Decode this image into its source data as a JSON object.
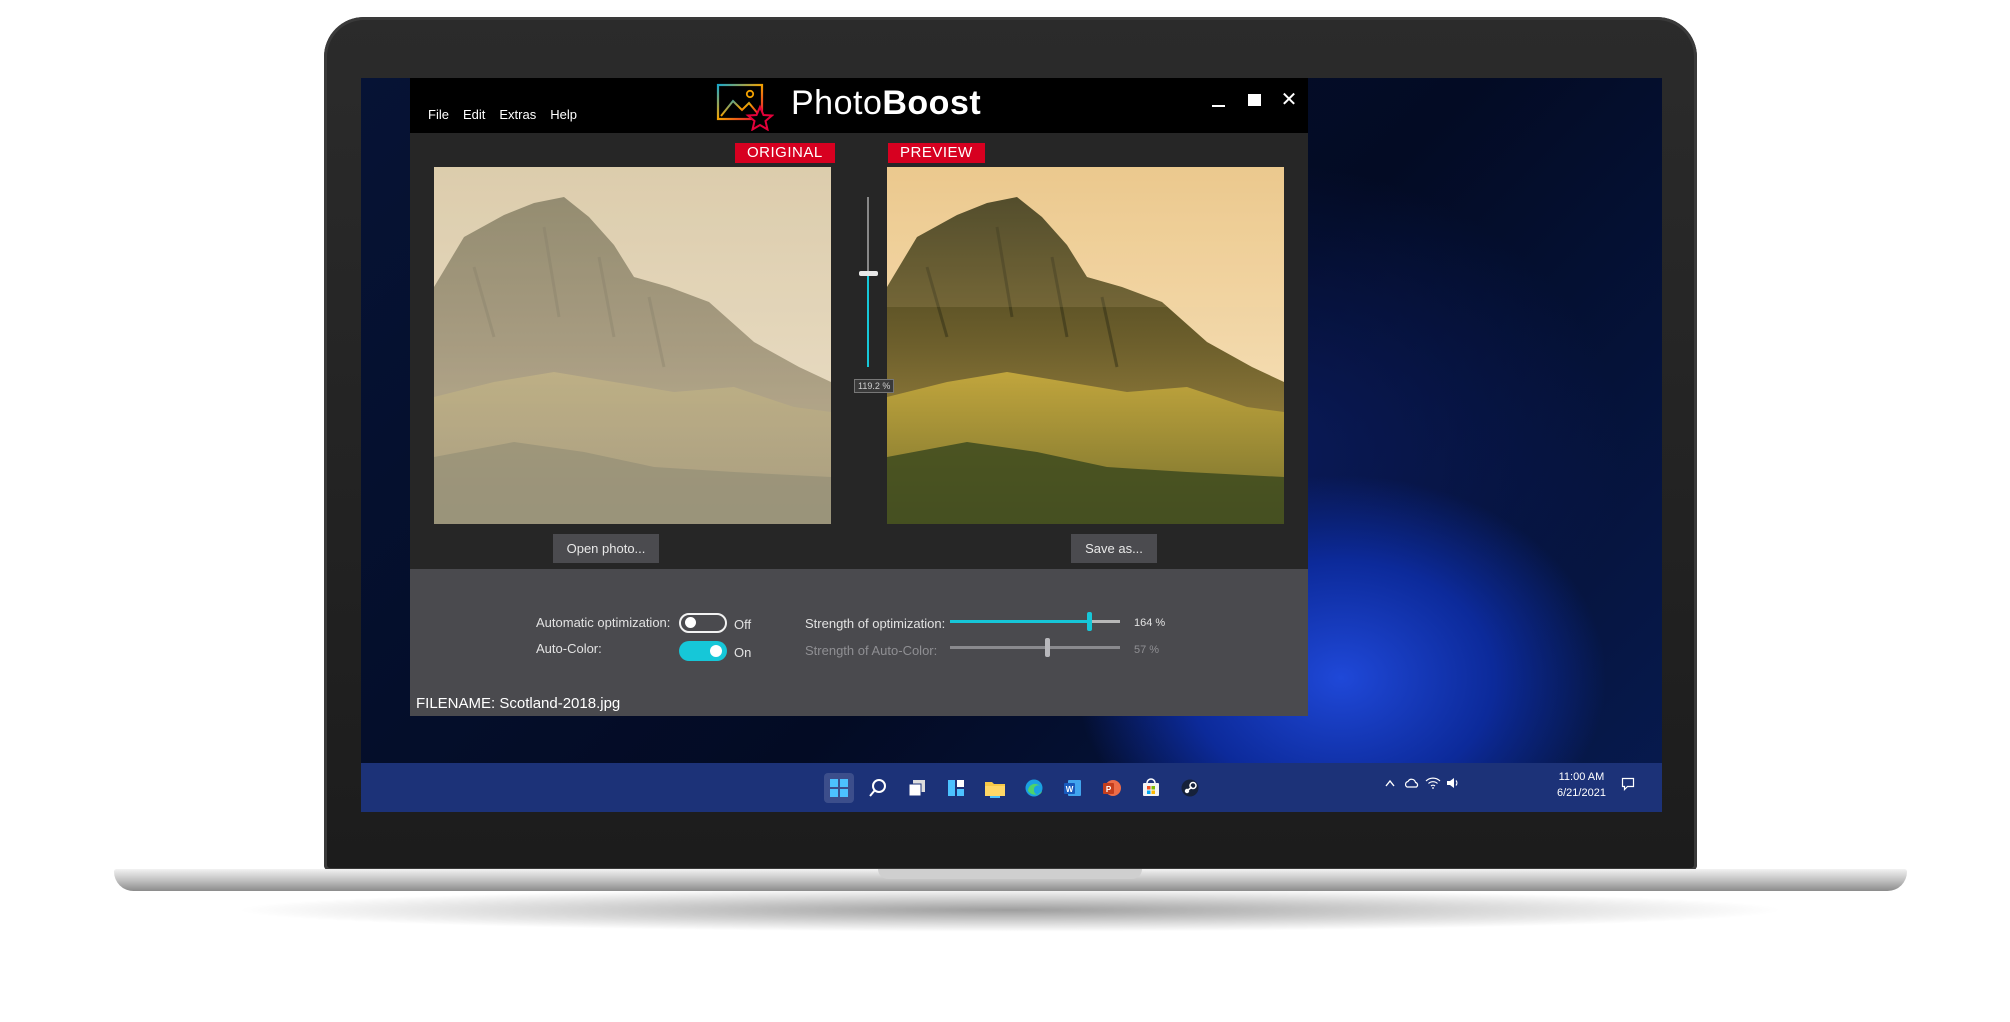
{
  "app": {
    "title_regular": "Photo",
    "title_bold": "Boost",
    "menu": [
      "File",
      "Edit",
      "Extras",
      "Help"
    ],
    "window_buttons": [
      "minimize-icon",
      "maximize-icon",
      "close-icon"
    ]
  },
  "compare": {
    "original_label": "ORIGINAL",
    "preview_label": "PREVIEW",
    "slider_value_text": "119.2 %",
    "slider_level": 0.55,
    "open_button": "Open photo...",
    "save_button": "Save as..."
  },
  "controls": {
    "auto_opt_label": "Automatic optimization:",
    "auto_opt_state": "Off",
    "auto_color_label": "Auto-Color:",
    "auto_color_state": "On",
    "strength_opt_label": "Strength of optimization:",
    "strength_opt_value": "164 %",
    "strength_opt_level": 0.82,
    "strength_color_label": "Strength of Auto-Color:",
    "strength_color_value": "57 %",
    "strength_color_level": 0.57
  },
  "status": {
    "filename": "FILENAME: Scotland-2018.jpg"
  },
  "taskbar": {
    "icons": [
      "windows-start-icon",
      "search-icon",
      "task-view-icon",
      "widgets-icon",
      "file-explorer-icon",
      "edge-icon",
      "word-icon",
      "powerpoint-icon",
      "store-icon",
      "steam-icon"
    ],
    "tray_icons": [
      "chevron-up-icon",
      "onedrive-icon",
      "wifi-icon",
      "volume-icon",
      "notification-icon"
    ],
    "time": "11:00 AM",
    "date": "6/21/2021"
  },
  "colors": {
    "accent": "#16c7d8",
    "label_red": "#d70020",
    "panel": "#4a4a4e",
    "workarea": "#262626"
  }
}
